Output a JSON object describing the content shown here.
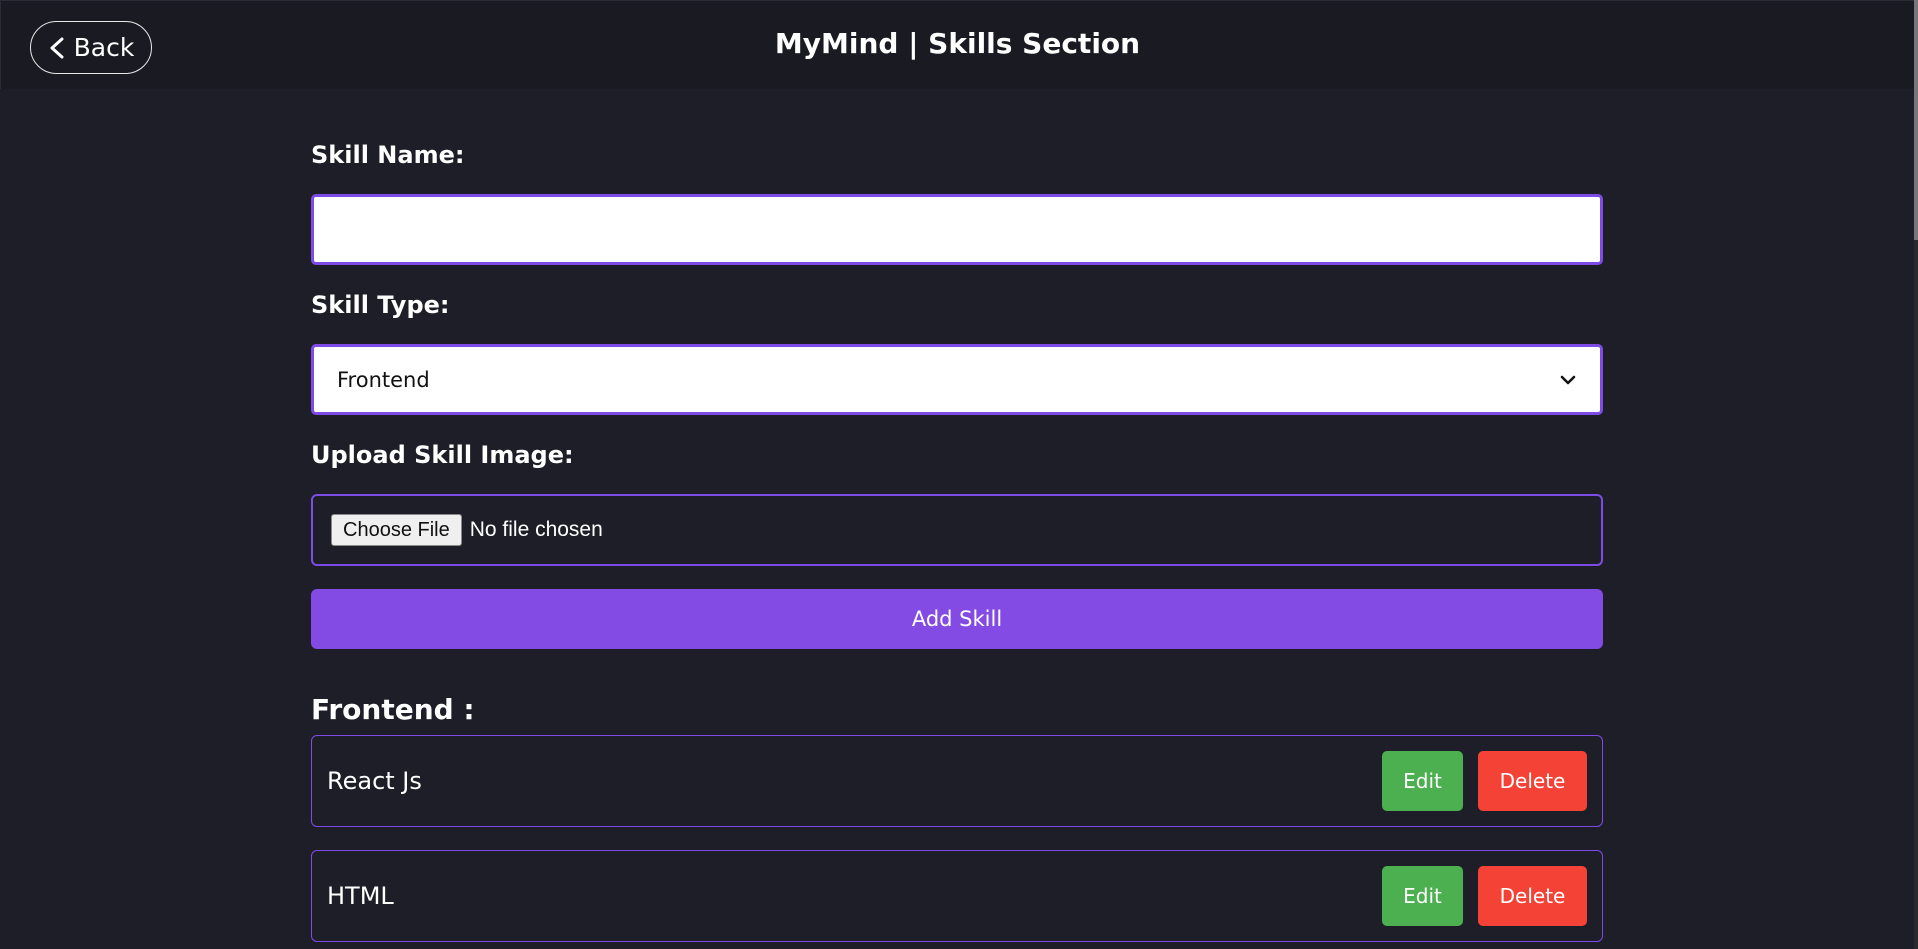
{
  "header": {
    "back_label": "Back",
    "title": "MyMind | Skills Section"
  },
  "form": {
    "skill_name_label": "Skill Name:",
    "skill_name_value": "",
    "skill_type_label": "Skill Type:",
    "skill_type_value": "Frontend",
    "upload_label": "Upload Skill Image:",
    "choose_file_label": "Choose File",
    "no_file_text": "No file chosen",
    "add_button_label": "Add Skill"
  },
  "skills_section": {
    "heading": "Frontend :",
    "edit_label": "Edit",
    "delete_label": "Delete",
    "items": [
      {
        "name": "React Js"
      },
      {
        "name": "HTML"
      }
    ]
  },
  "icons": {
    "back": "chevron-left-icon",
    "select": "chevron-down-icon"
  },
  "colors": {
    "background": "#1e1e28",
    "header": "#1a1a22",
    "accent": "#844ae4",
    "border_accent": "#7e4be6",
    "edit": "#4caf50",
    "delete": "#f44336"
  }
}
